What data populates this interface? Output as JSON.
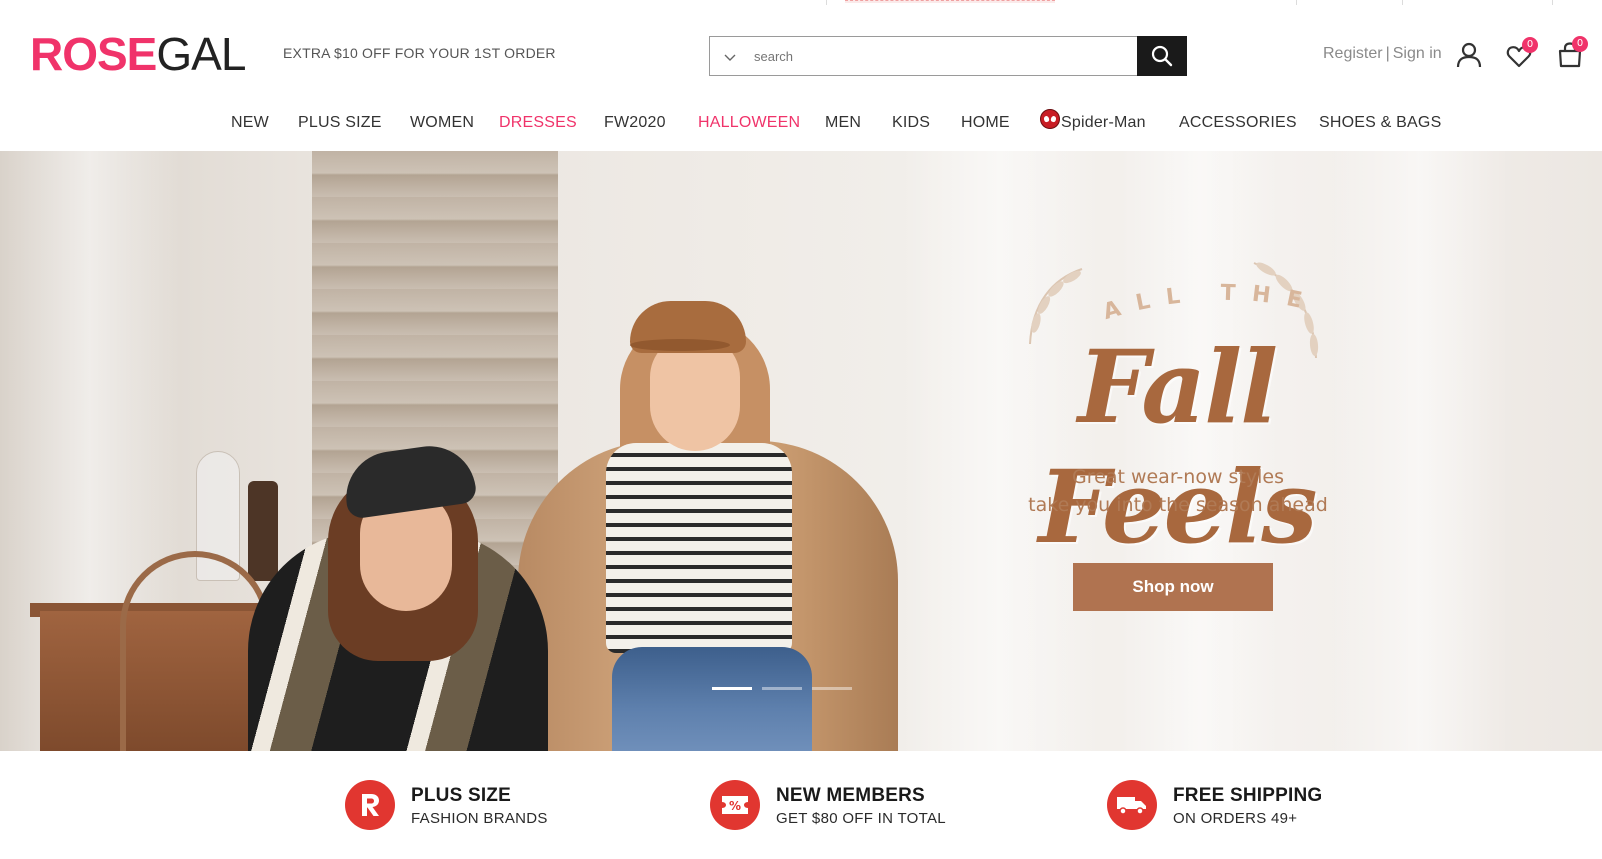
{
  "header": {
    "logo_part1": "ROSE",
    "logo_part2": "GAL",
    "promo": "EXTRA $10 OFF FOR YOUR 1ST ORDER",
    "search_placeholder": "search",
    "register": "Register",
    "separator": "|",
    "sign_in": "Sign in",
    "wishlist_count": "0",
    "bag_count": "0"
  },
  "nav": {
    "items": [
      {
        "label": "NEW",
        "highlight": false
      },
      {
        "label": "PLUS SIZE",
        "highlight": false
      },
      {
        "label": "WOMEN",
        "highlight": false
      },
      {
        "label": "DRESSES",
        "highlight": true
      },
      {
        "label": "FW2020",
        "highlight": false
      },
      {
        "label": "HALLOWEEN",
        "highlight": true
      },
      {
        "label": "MEN",
        "highlight": false
      },
      {
        "label": "KIDS",
        "highlight": false
      },
      {
        "label": "HOME",
        "highlight": false
      },
      {
        "label": "Spider-Man",
        "highlight": false,
        "icon": "spider-man-icon"
      },
      {
        "label": "ACCESSORIES",
        "highlight": false
      },
      {
        "label": "SHOES & BAGS",
        "highlight": false
      }
    ]
  },
  "hero": {
    "kicker": "ALL THE",
    "title": "Fall Feels",
    "subtitle_line1": "Great wear-now styles",
    "subtitle_line2": "take you into the season ahead",
    "cta": "Shop now",
    "slides_count": 3,
    "active_slide": 1
  },
  "features": [
    {
      "icon": "rosegal-r-icon",
      "title": "PLUS SIZE",
      "subtitle": "FASHION BRANDS"
    },
    {
      "icon": "percent-coupon-icon",
      "title": "NEW MEMBERS",
      "subtitle": "GET $80 OFF IN TOTAL"
    },
    {
      "icon": "delivery-truck-icon",
      "title": "FREE SHIPPING",
      "subtitle": "ON ORDERS 49+"
    }
  ],
  "colors": {
    "brand_pink": "#f0336a",
    "hero_brown": "#a8683e",
    "cta_brown": "#b07350",
    "feature_red": "#e13630",
    "search_button": "#1a1a1a"
  }
}
